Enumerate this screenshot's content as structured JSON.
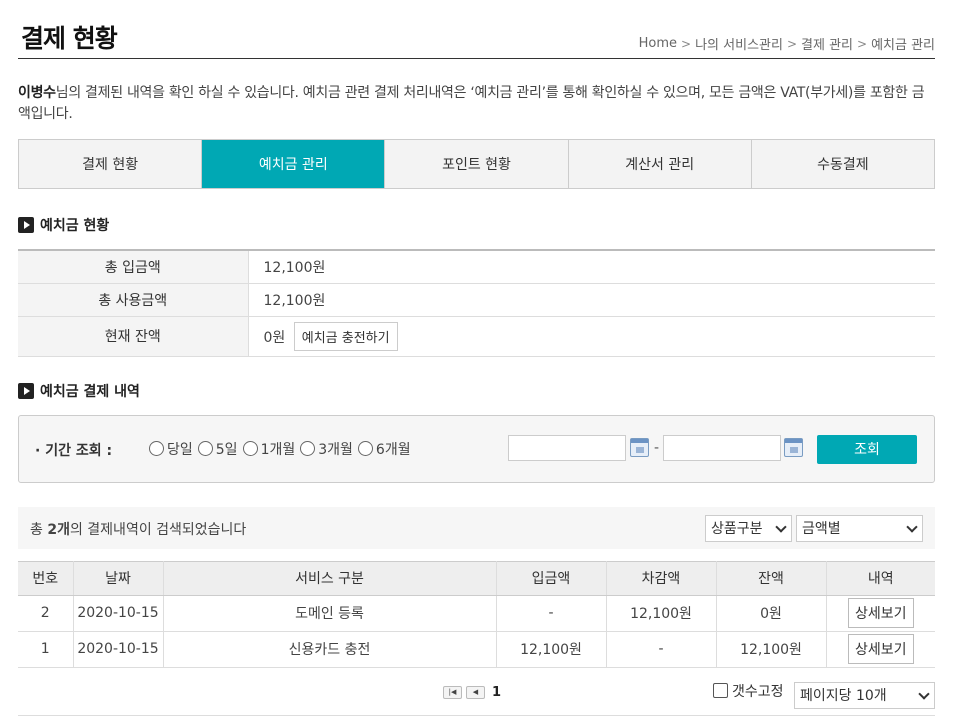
{
  "header": {
    "title": "결제 현황",
    "breadcrumb": [
      "Home",
      "나의 서비스관리",
      "결제 관리",
      "예치금 관리"
    ]
  },
  "intro": {
    "user": "이병수",
    "text": "님의 결제된 내역을 확인 하실 수 있습니다. 예치금 관련 결제 처리내역은 ‘예치금 관리’를 통해 확인하실 수 있으며, 모든 금액은 VAT(부가세)를 포함한 금액입니다."
  },
  "tabs": [
    {
      "label": "결제 현황",
      "active": false
    },
    {
      "label": "예치금 관리",
      "active": true
    },
    {
      "label": "포인트 현황",
      "active": false
    },
    {
      "label": "계산서 관리",
      "active": false
    },
    {
      "label": "수동결제",
      "active": false
    }
  ],
  "deposit_status": {
    "heading": "예치금 현황",
    "rows": [
      {
        "label": "총 입금액",
        "value": "12,100원"
      },
      {
        "label": "총 사용금액",
        "value": "12,100원"
      },
      {
        "label": "현재 잔액",
        "value": "0원"
      }
    ],
    "charge_button": "예치금 충전하기"
  },
  "history": {
    "heading": "예치금 결제 내역",
    "search": {
      "label": "· 기간 조회 :",
      "periods": [
        "당일",
        "5일",
        "1개월",
        "3개월",
        "6개월"
      ],
      "date_from": "",
      "date_to": "",
      "separator": "-",
      "button": "조회"
    },
    "result": {
      "prefix": "총 ",
      "count": "2개",
      "suffix": "의 결제내역이 검색되었습니다",
      "filter_product": "상품구분",
      "filter_amount": "금액별"
    },
    "columns": [
      "번호",
      "날짜",
      "서비스 구분",
      "입금액",
      "차감액",
      "잔액",
      "내역"
    ],
    "rows": [
      {
        "no": "2",
        "date": "2020-10-15",
        "service": "도메인 등록",
        "deposit": "-",
        "deduct": "12,100원",
        "balance": "0원",
        "detail": "상세보기"
      },
      {
        "no": "1",
        "date": "2020-10-15",
        "service": "신용카드 충전",
        "deposit": "12,100원",
        "deduct": "-",
        "balance": "12,100원",
        "detail": "상세보기"
      }
    ],
    "pager": {
      "first": "|◀",
      "prev": "◀",
      "current": "1"
    },
    "fix_count_label": "갯수고정",
    "per_page": "페이지당 10개"
  },
  "colors": {
    "accent": "#00a8b4"
  }
}
